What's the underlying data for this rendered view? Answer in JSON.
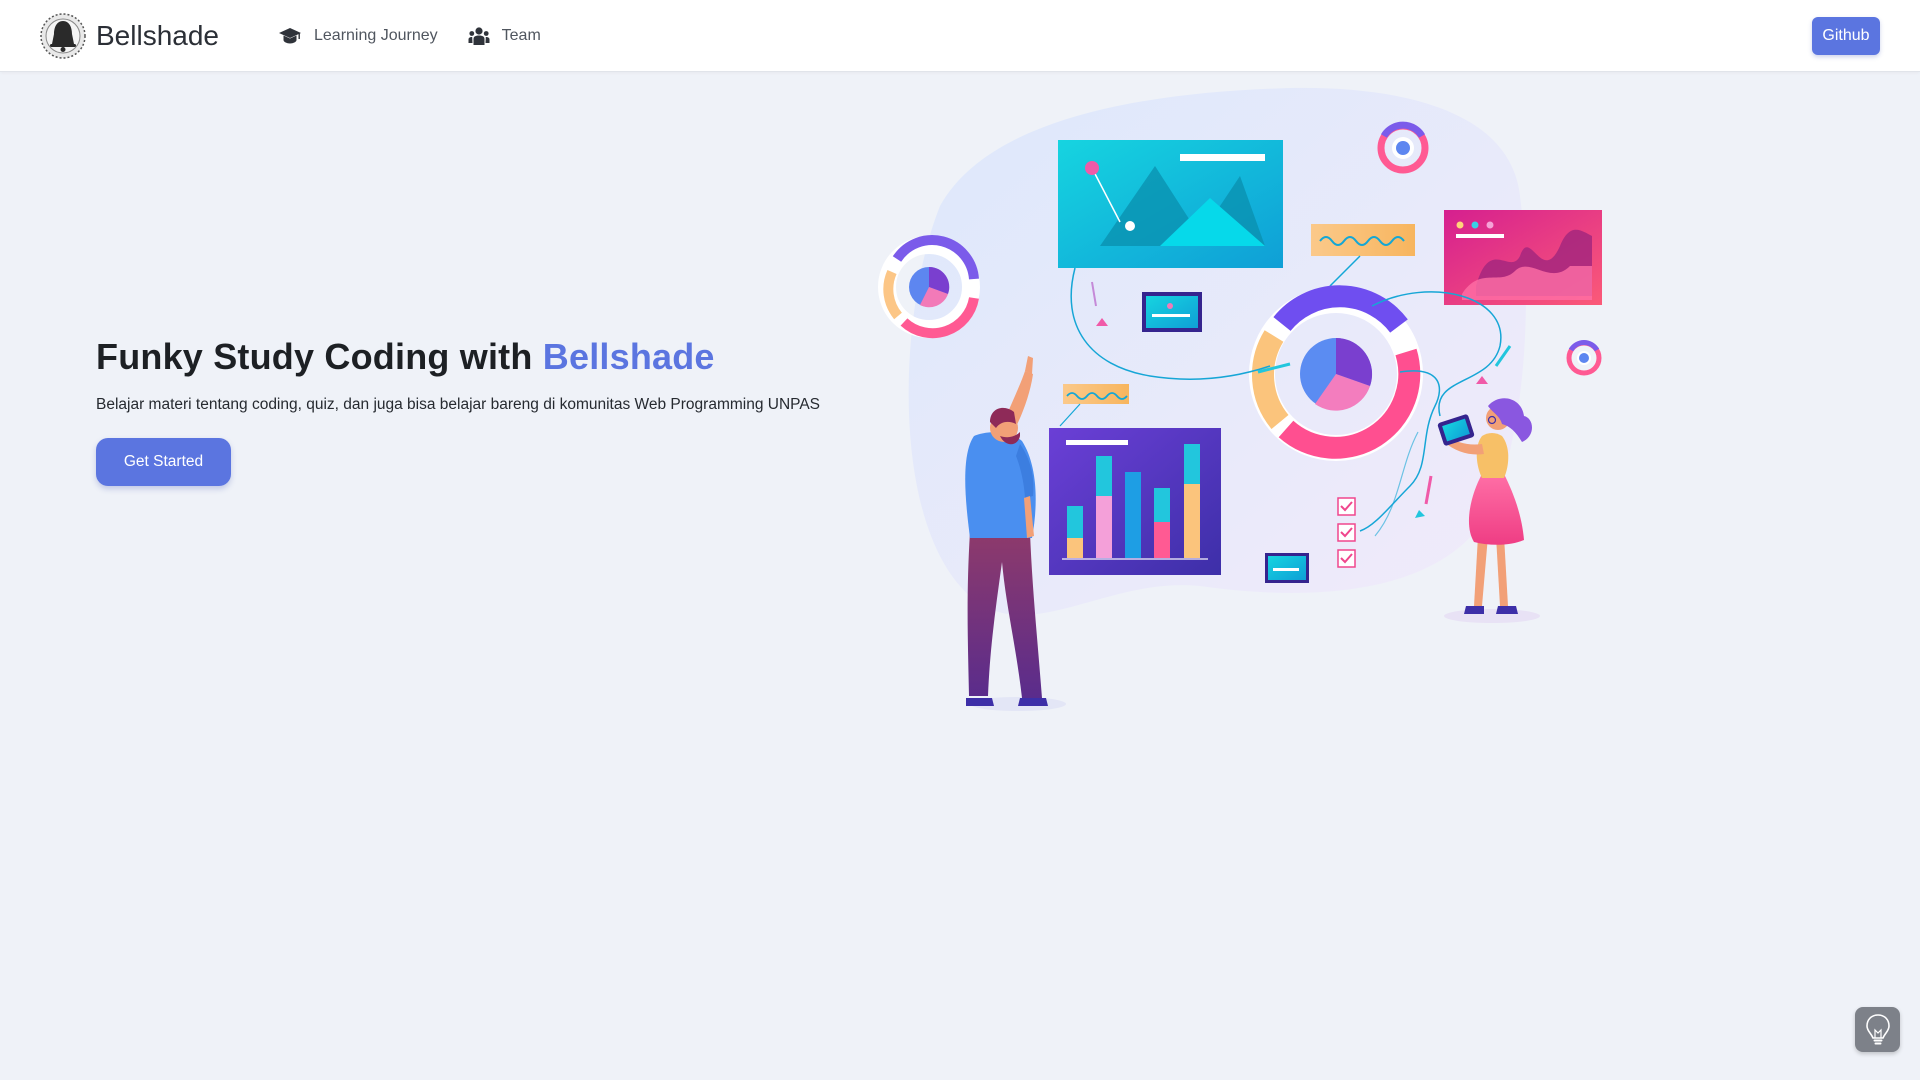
{
  "navbar": {
    "brand_name": "Bellshade",
    "links": [
      {
        "label": "Learning Journey",
        "icon": "graduation-cap-icon"
      },
      {
        "label": "Team",
        "icon": "users-icon"
      }
    ],
    "github_label": "Github"
  },
  "hero": {
    "title_prefix": "Funky Study Coding with ",
    "title_brand": "Bellshade",
    "subtitle": "Belajar materi tentang coding, quiz, dan juga bisa belajar bareng di komunitas Web Programming UNPAS",
    "cta_label": "Get Started"
  },
  "illustration": {
    "icon": "data-analytics-illustration"
  },
  "help": {
    "icon": "lightbulb-icon"
  },
  "colors": {
    "accent": "#5b75e0",
    "background": "#eff2f8",
    "help_button": "#7d8189"
  }
}
